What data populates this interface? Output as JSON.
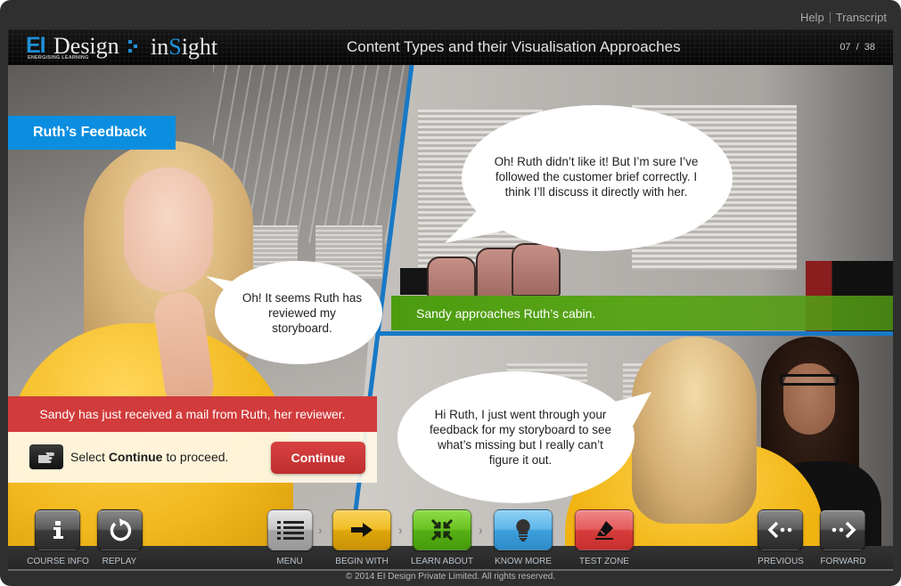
{
  "top_links": {
    "help": "Help",
    "transcript": "Transcript"
  },
  "header": {
    "logo_ei": "EI",
    "logo_design": "Design",
    "logo_tagline": "ENERGISING LEARNING",
    "logo_insight_pre": "in",
    "logo_insight_s": "S",
    "logo_insight_post": "ight",
    "title": "Content Types and their Visualisation Approaches",
    "page_current": "07",
    "page_sep": "/",
    "page_total": "38"
  },
  "stage": {
    "section_tag": "Ruth’s Feedback",
    "caption_green": "Sandy approaches Ruth’s cabin.",
    "bubbles": [
      {
        "text": "Oh! It seems Ruth has reviewed my storyboard."
      },
      {
        "text": "Oh! Ruth didn’t like it! But I’m sure I’ve followed the customer brief correctly. I think I’ll discuss it directly with her."
      },
      {
        "text": "Hi Ruth, I just went through your feedback for my storyboard to see what’s missing but I really can’t figure it out."
      }
    ],
    "instruction": {
      "headline": "Sandy has just received a mail from Ruth, her reviewer.",
      "prompt_pre": "Select ",
      "prompt_bold": "Continue",
      "prompt_post": " to proceed.",
      "continue_label": "Continue",
      "icon": "pointing-hand-icon"
    }
  },
  "colors": {
    "brand_blue": "#0c8ee0",
    "divider_blue": "#1879c6",
    "caption_green": "#52a013",
    "alert_red": "#d13b3b"
  },
  "nav": {
    "buttons": [
      {
        "id": "course-info",
        "label": "COURSE INFO",
        "icon": "info-icon"
      },
      {
        "id": "replay",
        "label": "REPLAY",
        "icon": "replay-icon"
      },
      {
        "id": "menu",
        "label": "MENU",
        "icon": "list-icon"
      },
      {
        "id": "begin-with",
        "label": "BEGIN WITH",
        "icon": "arrow-right-icon"
      },
      {
        "id": "learn-about",
        "label": "LEARN ABOUT",
        "icon": "collapse-arrows-icon"
      },
      {
        "id": "know-more",
        "label": "KNOW MORE",
        "icon": "lightbulb-icon"
      },
      {
        "id": "test-zone",
        "label": "TEST ZONE",
        "icon": "eraser-icon"
      },
      {
        "id": "previous",
        "label": "PREVIOUS",
        "icon": "previous-icon"
      },
      {
        "id": "forward",
        "label": "FORWARD",
        "icon": "forward-icon"
      }
    ],
    "separator": "›"
  },
  "footer": {
    "copyright": "© 2014 EI Design Private Limited. All rights reserved."
  }
}
